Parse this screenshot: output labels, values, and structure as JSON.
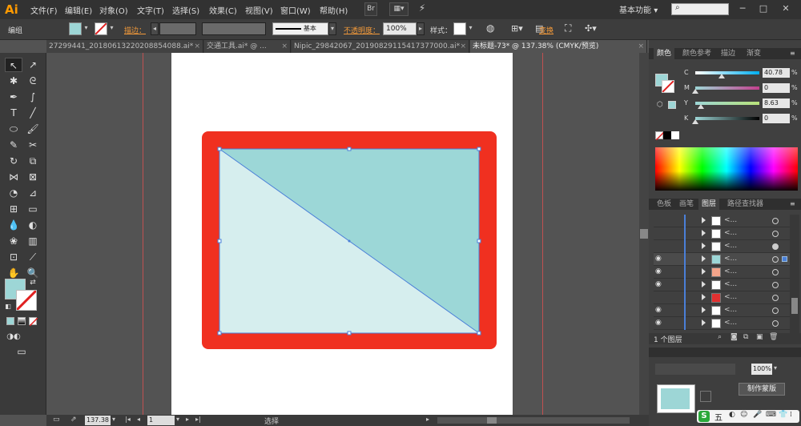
{
  "app": {
    "logo": "Ai"
  },
  "menu": [
    "文件(F)",
    "编辑(E)",
    "对象(O)",
    "文字(T)",
    "选择(S)",
    "效果(C)",
    "视图(V)",
    "窗口(W)",
    "帮助(H)"
  ],
  "menubar_buttons": {
    "br": "Br"
  },
  "workspace": {
    "label": "基本功能",
    "chevron": "▾"
  },
  "window_controls": {
    "minimize": "─",
    "restore": "□",
    "close": "✕"
  },
  "control_bar": {
    "selection_label": "编组",
    "stroke_label": "描边：",
    "stroke_style": "基本",
    "opacity_label": "不透明度：",
    "opacity_value": "100%",
    "style_label": "样式：",
    "transform_label": "变换"
  },
  "colors": {
    "fill_swatch": "#9dd6d6",
    "red_frame": "#f03020",
    "teal_triangle": "#9cd7d7",
    "light_triangle": "#d6eeee",
    "panel_tab_active": "#404040"
  },
  "doc_tabs": [
    {
      "label": "27299441_20180613220208854088.ai*",
      "close": "×"
    },
    {
      "label": "交通工具.ai* @ ...",
      "close": "×"
    },
    {
      "label": "Nipic_29842067_20190829115417377000.ai*",
      "close": "×"
    },
    {
      "label": "未标题-73* @ 137.38% (CMYK/预览)",
      "close": "×"
    }
  ],
  "status_bar": {
    "zoom": "137.38",
    "artboard_number": "1",
    "current_tool": "选择"
  },
  "color_panel": {
    "tabs": [
      "颜色",
      "颜色参考",
      "描边",
      "渐变"
    ],
    "sliders": [
      {
        "letter": "C",
        "value": "40.78",
        "unit": "%",
        "fraction": 0.41,
        "gradient": "linear-gradient(to right,#ffffff,#00aeef)"
      },
      {
        "letter": "M",
        "value": "0",
        "unit": "%",
        "fraction": 0.0,
        "gradient": "linear-gradient(to right,#9dd6d6,#c33f8d)"
      },
      {
        "letter": "Y",
        "value": "8.63",
        "unit": "%",
        "fraction": 0.09,
        "gradient": "linear-gradient(to right,#9dd6d6,#b9e37a)"
      },
      {
        "letter": "K",
        "value": "0",
        "unit": "%",
        "fraction": 0.0,
        "gradient": "linear-gradient(to right,#9dd6d6,#000000)"
      }
    ]
  },
  "layers_panel": {
    "tabs": [
      "色板",
      "画笔",
      "图层",
      "路径查找器"
    ],
    "rows": [
      {
        "name": "<...",
        "thumb": "#ffffff",
        "eye": false,
        "selected": false,
        "target_filled": false
      },
      {
        "name": "<...",
        "thumb": "#ffffff",
        "eye": false,
        "selected": false,
        "target_filled": false
      },
      {
        "name": "<...",
        "thumb": "#ffffff",
        "eye": false,
        "selected": false,
        "target_filled": true
      },
      {
        "name": "<...",
        "thumb": "#9dd6d6",
        "eye": true,
        "selected": true,
        "target_filled": false
      },
      {
        "name": "<...",
        "thumb": "#f4a48a",
        "eye": true,
        "selected": false,
        "target_filled": false
      },
      {
        "name": "<...",
        "thumb": "#ffffff",
        "eye": true,
        "selected": false,
        "target_filled": false
      },
      {
        "name": "<...",
        "thumb": "#e03030",
        "eye": false,
        "selected": false,
        "target_filled": false
      },
      {
        "name": "<...",
        "thumb": "#ffffff",
        "eye": true,
        "selected": false,
        "target_filled": false
      },
      {
        "name": "<...",
        "thumb": "#ffffff",
        "eye": true,
        "selected": false,
        "target_filled": false
      }
    ],
    "footer_label": "1 个图层"
  },
  "lower_panel": {
    "opacity_value": "100%",
    "make_mask_button": "制作蒙版"
  },
  "ime": {
    "badge": "S",
    "mode": "五"
  }
}
